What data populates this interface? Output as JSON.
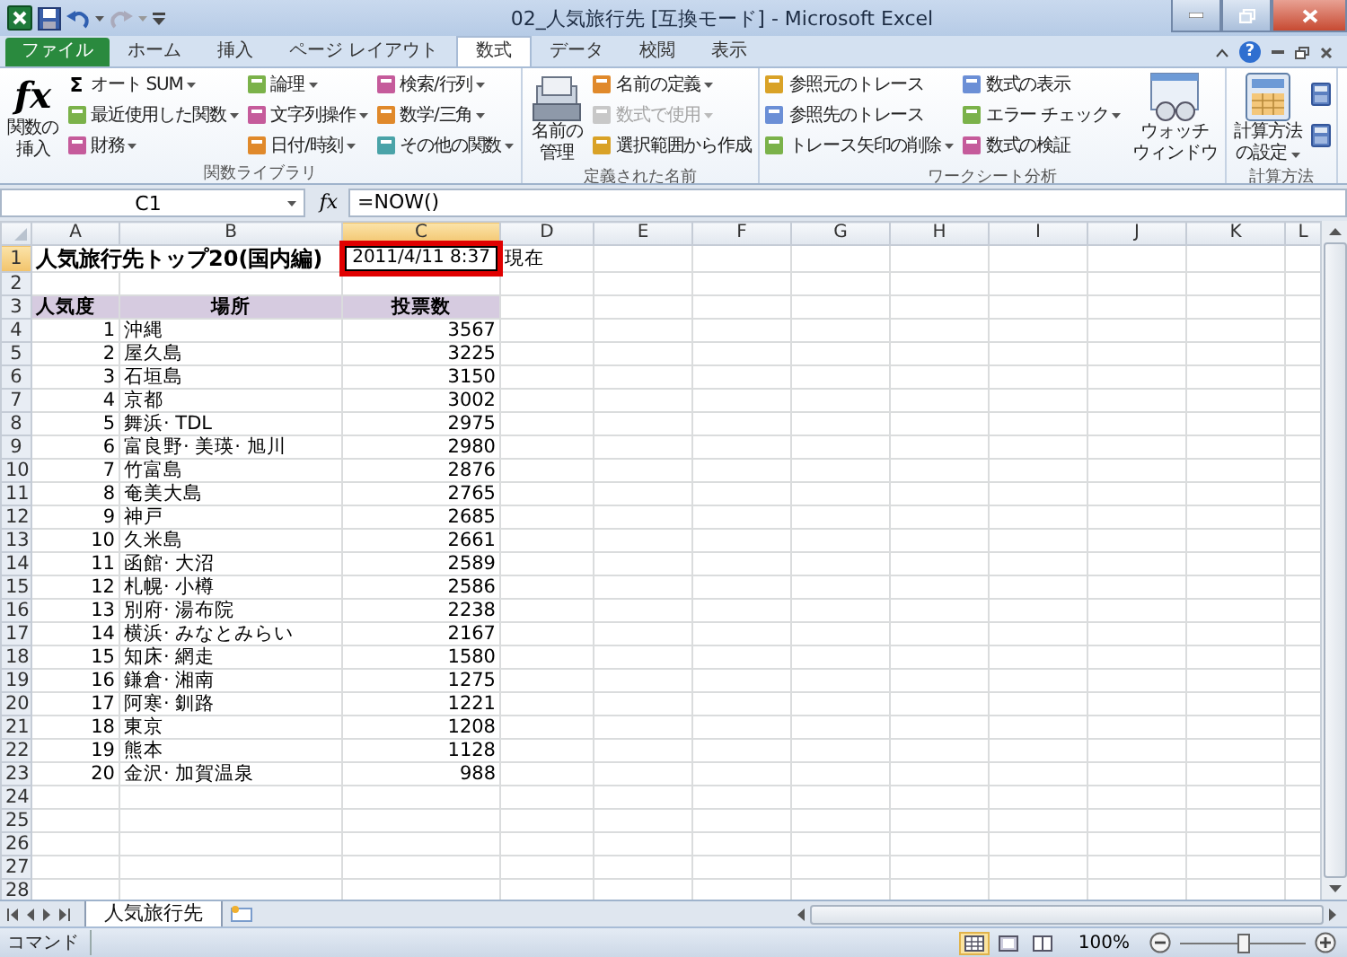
{
  "window": {
    "title": "02_人気旅行先 [互換モード] - Microsoft Excel"
  },
  "ribbon_tabs": [
    {
      "label": "ファイル",
      "kind": "file",
      "selected": false
    },
    {
      "label": "ホーム",
      "kind": "tab",
      "selected": false
    },
    {
      "label": "挿入",
      "kind": "tab",
      "selected": false
    },
    {
      "label": "ページ レイアウト",
      "kind": "tab",
      "selected": false
    },
    {
      "label": "数式",
      "kind": "tab",
      "selected": true
    },
    {
      "label": "データ",
      "kind": "tab",
      "selected": false
    },
    {
      "label": "校閲",
      "kind": "tab",
      "selected": false
    },
    {
      "label": "表示",
      "kind": "tab",
      "selected": false
    }
  ],
  "help": "?",
  "ribbon_groups": [
    {
      "label": "関数ライブラリ",
      "parts": [
        {
          "kind": "large",
          "glyph": "fx",
          "label_lines": [
            "関数の",
            "挿入"
          ],
          "dropdown": false
        },
        {
          "kind": "stack",
          "items": [
            {
              "glyph": "Σ",
              "label": "オート SUM",
              "dropdown": true,
              "disabled": false
            },
            {
              "label": "最近使用した関数",
              "dropdown": true,
              "disabled": false
            },
            {
              "label": "財務",
              "dropdown": true,
              "disabled": false
            }
          ]
        },
        {
          "kind": "stack",
          "items": [
            {
              "label": "論理",
              "dropdown": true,
              "disabled": false
            },
            {
              "label": "文字列操作",
              "dropdown": true,
              "disabled": false
            },
            {
              "label": "日付/時刻",
              "dropdown": true,
              "disabled": false
            }
          ]
        },
        {
          "kind": "stack",
          "items": [
            {
              "label": "検索/行列",
              "dropdown": true,
              "disabled": false
            },
            {
              "label": "数学/三角",
              "dropdown": true,
              "disabled": false
            },
            {
              "label": "その他の関数",
              "dropdown": true,
              "disabled": false
            }
          ]
        }
      ]
    },
    {
      "label": "定義された名前",
      "parts": [
        {
          "kind": "large",
          "label_lines": [
            "名前の",
            "管理"
          ],
          "dropdown": false
        },
        {
          "kind": "stack",
          "items": [
            {
              "label": "名前の定義",
              "dropdown": true,
              "disabled": false
            },
            {
              "label": "数式で使用",
              "dropdown": true,
              "disabled": true
            },
            {
              "label": "選択範囲から作成",
              "dropdown": false,
              "disabled": false
            }
          ]
        }
      ]
    },
    {
      "label": "ワークシート分析",
      "parts": [
        {
          "kind": "stack",
          "items": [
            {
              "label": "参照元のトレース",
              "dropdown": false,
              "disabled": false
            },
            {
              "label": "参照先のトレース",
              "dropdown": false,
              "disabled": false
            },
            {
              "label": "トレース矢印の削除",
              "dropdown": true,
              "disabled": false
            }
          ]
        },
        {
          "kind": "stack",
          "items": [
            {
              "label": "数式の表示",
              "dropdown": false,
              "disabled": false
            },
            {
              "label": "エラー チェック",
              "dropdown": true,
              "disabled": false
            },
            {
              "label": "数式の検証",
              "dropdown": false,
              "disabled": false
            }
          ]
        },
        {
          "kind": "large",
          "label_lines": [
            "ウォッチ",
            "ウィンドウ"
          ],
          "dropdown": false
        }
      ]
    },
    {
      "label": "計算方法",
      "parts": [
        {
          "kind": "large",
          "label_lines": [
            "計算方法",
            "の設定"
          ],
          "dropdown": true
        },
        {
          "kind": "icons"
        }
      ]
    }
  ],
  "formula_bar": {
    "name_box": "C1",
    "glyph": "fx",
    "formula": "=NOW()"
  },
  "columns": [
    {
      "label": "A",
      "selected": false
    },
    {
      "label": "B",
      "selected": false
    },
    {
      "label": "C",
      "selected": true
    },
    {
      "label": "D",
      "selected": false
    },
    {
      "label": "E",
      "selected": false
    },
    {
      "label": "F",
      "selected": false
    },
    {
      "label": "G",
      "selected": false
    },
    {
      "label": "H",
      "selected": false
    },
    {
      "label": "I",
      "selected": false
    },
    {
      "label": "J",
      "selected": false
    },
    {
      "label": "K",
      "selected": false
    },
    {
      "label": "L",
      "selected": false
    }
  ],
  "rows": [
    {
      "kind": "title",
      "number": "1",
      "selected": true,
      "title": "人気旅行先トップ20(国内編)",
      "value": "2011/4/11  8:37",
      "note": "現在"
    },
    {
      "kind": "blank",
      "number": "2",
      "selected": false
    },
    {
      "kind": "header",
      "number": "3",
      "selected": false,
      "cells": [
        "人気度",
        "場所",
        "投票数"
      ]
    },
    {
      "kind": "data",
      "number": "4",
      "selected": false,
      "rank": "1",
      "place": "沖縄",
      "votes": "3567"
    },
    {
      "kind": "data",
      "number": "5",
      "selected": false,
      "rank": "2",
      "place": "屋久島",
      "votes": "3225"
    },
    {
      "kind": "data",
      "number": "6",
      "selected": false,
      "rank": "3",
      "place": "石垣島",
      "votes": "3150"
    },
    {
      "kind": "data",
      "number": "7",
      "selected": false,
      "rank": "4",
      "place": "京都",
      "votes": "3002"
    },
    {
      "kind": "data",
      "number": "8",
      "selected": false,
      "rank": "5",
      "place": "舞浜· TDL",
      "votes": "2975"
    },
    {
      "kind": "data",
      "number": "9",
      "selected": false,
      "rank": "6",
      "place": "富良野· 美瑛· 旭川",
      "votes": "2980"
    },
    {
      "kind": "data",
      "number": "10",
      "selected": false,
      "rank": "7",
      "place": "竹富島",
      "votes": "2876"
    },
    {
      "kind": "data",
      "number": "11",
      "selected": false,
      "rank": "8",
      "place": "奄美大島",
      "votes": "2765"
    },
    {
      "kind": "data",
      "number": "12",
      "selected": false,
      "rank": "9",
      "place": "神戸",
      "votes": "2685"
    },
    {
      "kind": "data",
      "number": "13",
      "selected": false,
      "rank": "10",
      "place": "久米島",
      "votes": "2661"
    },
    {
      "kind": "data",
      "number": "14",
      "selected": false,
      "rank": "11",
      "place": "函館· 大沼",
      "votes": "2589"
    },
    {
      "kind": "data",
      "number": "15",
      "selected": false,
      "rank": "12",
      "place": "札幌· 小樽",
      "votes": "2586"
    },
    {
      "kind": "data",
      "number": "16",
      "selected": false,
      "rank": "13",
      "place": "別府· 湯布院",
      "votes": "2238"
    },
    {
      "kind": "data",
      "number": "17",
      "selected": false,
      "rank": "14",
      "place": "横浜· みなとみらい",
      "votes": "2167"
    },
    {
      "kind": "data",
      "number": "18",
      "selected": false,
      "rank": "15",
      "place": "知床· 網走",
      "votes": "1580"
    },
    {
      "kind": "data",
      "number": "19",
      "selected": false,
      "rank": "16",
      "place": "鎌倉· 湘南",
      "votes": "1275"
    },
    {
      "kind": "data",
      "number": "20",
      "selected": false,
      "rank": "17",
      "place": "阿寒· 釧路",
      "votes": "1221"
    },
    {
      "kind": "data",
      "number": "21",
      "selected": false,
      "rank": "18",
      "place": "東京",
      "votes": "1208"
    },
    {
      "kind": "data",
      "number": "22",
      "selected": false,
      "rank": "19",
      "place": "熊本",
      "votes": "1128"
    },
    {
      "kind": "data",
      "number": "23",
      "selected": false,
      "rank": "20",
      "place": "金沢· 加賀温泉",
      "votes": "988"
    },
    {
      "kind": "blank",
      "number": "24",
      "selected": false
    },
    {
      "kind": "blank",
      "number": "25",
      "selected": false
    },
    {
      "kind": "blank",
      "number": "26",
      "selected": false
    },
    {
      "kind": "blank",
      "number": "27",
      "selected": false
    },
    {
      "kind": "blank",
      "number": "28",
      "selected": false
    }
  ],
  "sheet_tabs": [
    {
      "label": "人気旅行先",
      "selected": true
    }
  ],
  "status_bar": {
    "mode": "コマンド",
    "zoom": "100%",
    "level": 0.5
  }
}
